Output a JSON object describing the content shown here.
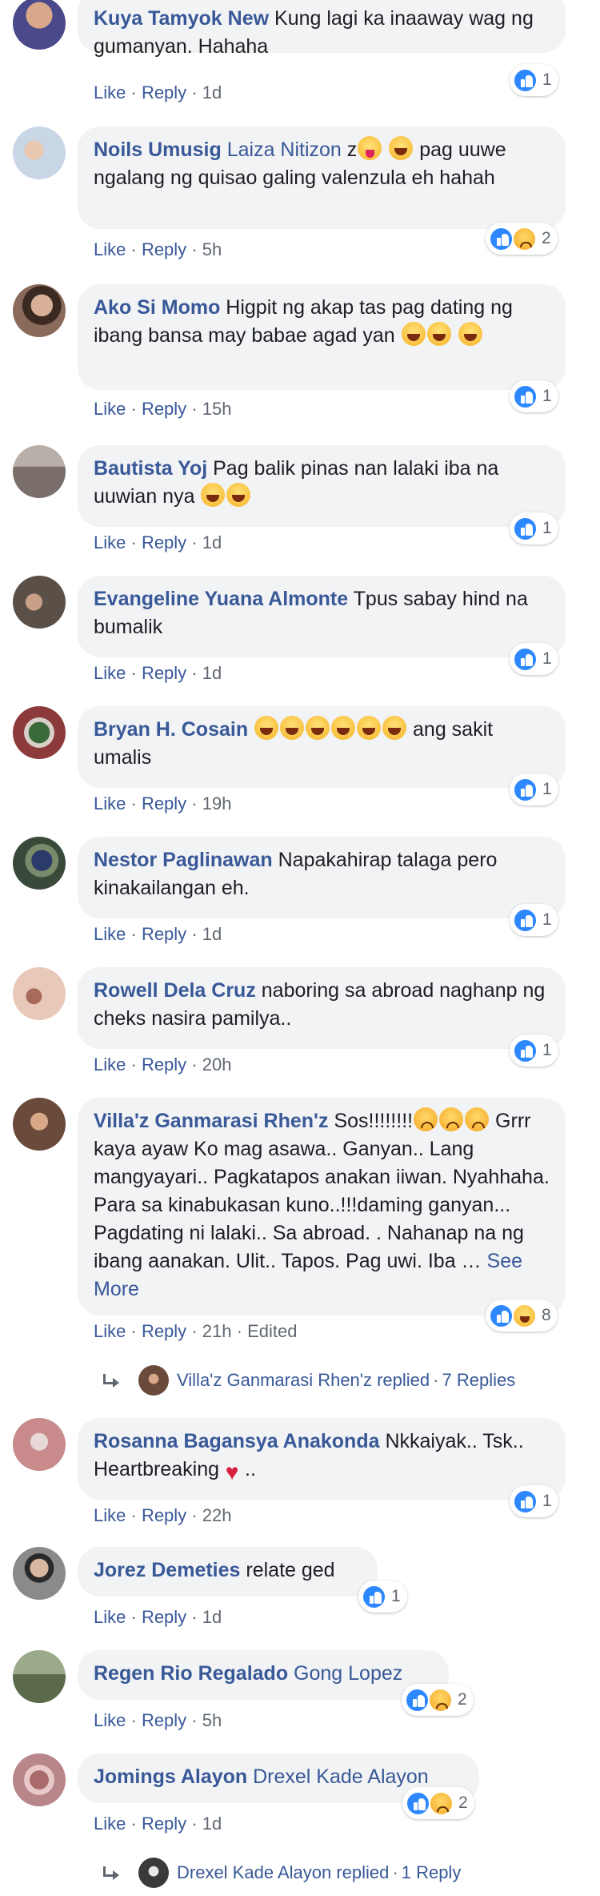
{
  "actions": {
    "like": "Like",
    "reply": "Reply",
    "dot": "·",
    "edited": "Edited"
  },
  "comments": [
    {
      "author": "Kuya Tamyok New",
      "tag": "",
      "text": "Kung lagi ka inaaway wag ng gumanyan. Hahaha",
      "time": "1d",
      "reactions": [
        "like"
      ],
      "reaction_count": "1",
      "avatar_color": "#4a4a8a"
    },
    {
      "author": "Noils Umusig",
      "tag": "Laiza Nitizon",
      "text": "z",
      "text_after": "pag uuwe ngalang ng quisao galing valenzula eh hahah",
      "time": "5h",
      "reactions": [
        "like",
        "sad"
      ],
      "reaction_count": "2",
      "avatar_color": "#c9d6e6"
    },
    {
      "author": "Ako Si Momo",
      "tag": "",
      "text": "Higpit ng akap tas pag dating ng ibang bansa may babae agad yan",
      "time": "15h",
      "reactions": [
        "like"
      ],
      "reaction_count": "1",
      "avatar_color": "#8a6a5a"
    },
    {
      "author": "Bautista Yoj",
      "tag": "",
      "text": "Pag balik pinas nan lalaki iba na uuwian nya",
      "time": "1d",
      "reactions": [
        "like"
      ],
      "reaction_count": "1",
      "avatar_color": "#7a6f6a"
    },
    {
      "author": "Evangeline Yuana Almonte",
      "tag": "",
      "text": "Tpus sabay hind na bumalik",
      "time": "1d",
      "reactions": [
        "like"
      ],
      "reaction_count": "1",
      "avatar_color": "#5a5048"
    },
    {
      "author": "Bryan H. Cosain",
      "tag": "",
      "text": "ang sakit umalis",
      "time": "19h",
      "reactions": [
        "like"
      ],
      "reaction_count": "1",
      "avatar_color": "#8c3a3a"
    },
    {
      "author": "Nestor Paglinawan",
      "tag": "",
      "text": "Napakahirap talaga pero kinakailangan eh.",
      "time": "1d",
      "reactions": [
        "like"
      ],
      "reaction_count": "1",
      "avatar_color": "#3a4a3a"
    },
    {
      "author": "Rowell Dela Cruz",
      "tag": "",
      "text": "naboring sa abroad naghanp ng cheks nasira pamilya..",
      "time": "20h",
      "reactions": [
        "like"
      ],
      "reaction_count": "1",
      "avatar_color": "#d8a890"
    },
    {
      "author": "Villa'z Ganmarasi Rhen'z",
      "tag": "",
      "text": "Sos!!!!!!!!",
      "text_after": "Grrr kaya ayaw Ko mag asawa.. Ganyan.. Lang mangyayari.. Pagkatapos anakan iiwan. Nyahhaha. Para sa kinabukasan kuno..!!!daming ganyan... Pagdating ni lalaki.. Sa abroad. . Nahanap na ng ibang aanakan. Ulit.. Tapos. Pag uwi. Iba …",
      "see_more": "See More",
      "time": "21h",
      "edited": true,
      "reactions": [
        "like",
        "haha"
      ],
      "reaction_count": "8",
      "avatar_color": "#6a4a3a",
      "replies": {
        "name": "Villa'z Ganmarasi Rhen'z replied",
        "count": "7 Replies"
      }
    },
    {
      "author": "Rosanna Bagansya Anakonda",
      "tag": "",
      "text": "Nkkaiyak.. Tsk.. Heartbreaking",
      "text_after": "..",
      "time": "22h",
      "reactions": [
        "like"
      ],
      "reaction_count": "1",
      "avatar_color": "#c88a8a"
    },
    {
      "author": "Jorez Demeties",
      "tag": "",
      "text": "relate ged",
      "time": "1d",
      "reactions": [
        "like"
      ],
      "reaction_count": "1",
      "avatar_color": "#5a5a5a"
    },
    {
      "author": "Regen Rio Regalado",
      "tag": "Gong Lopez",
      "text": "",
      "time": "5h",
      "reactions": [
        "like",
        "sad"
      ],
      "reaction_count": "2",
      "avatar_color": "#5a6a4a"
    },
    {
      "author": "Jomings Alayon",
      "tag": "Drexel Kade Alayon",
      "text": "",
      "time": "1d",
      "reactions": [
        "like",
        "sad"
      ],
      "reaction_count": "2",
      "avatar_color": "#b8868a",
      "replies": {
        "name": "Drexel Kade Alayon replied",
        "count": "1 Reply"
      }
    }
  ]
}
